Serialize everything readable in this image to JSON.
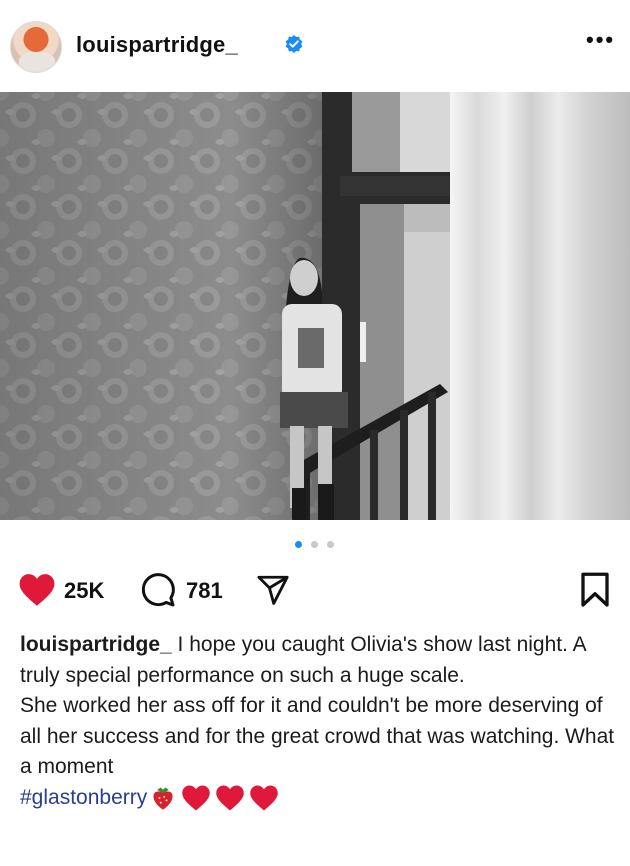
{
  "post": {
    "username": "louispartridge_",
    "likes": "25K",
    "comments": "781",
    "carousel": {
      "count": 3,
      "active_index": 0
    },
    "caption": {
      "username": "louispartridge_",
      "line1": " I hope you caught Olivia's show last night. A truly special performance on such a huge scale.",
      "line2": "She worked her ass off for it and couldn't be more deserving of all her success and for the great crowd that was watching. What a moment",
      "hashtag": "#glastonberry"
    }
  },
  "icons": {
    "like": "heart-icon",
    "comment": "comment-bubble-icon",
    "share": "paper-plane-icon",
    "save": "bookmark-icon",
    "more": "more-options-icon",
    "verified": "verified-badge-icon"
  },
  "colors": {
    "like": "#e0183a",
    "carousel_active": "#1a8cf5",
    "hashtag": "#2a3f8f",
    "verified": "#1a8cf5"
  }
}
